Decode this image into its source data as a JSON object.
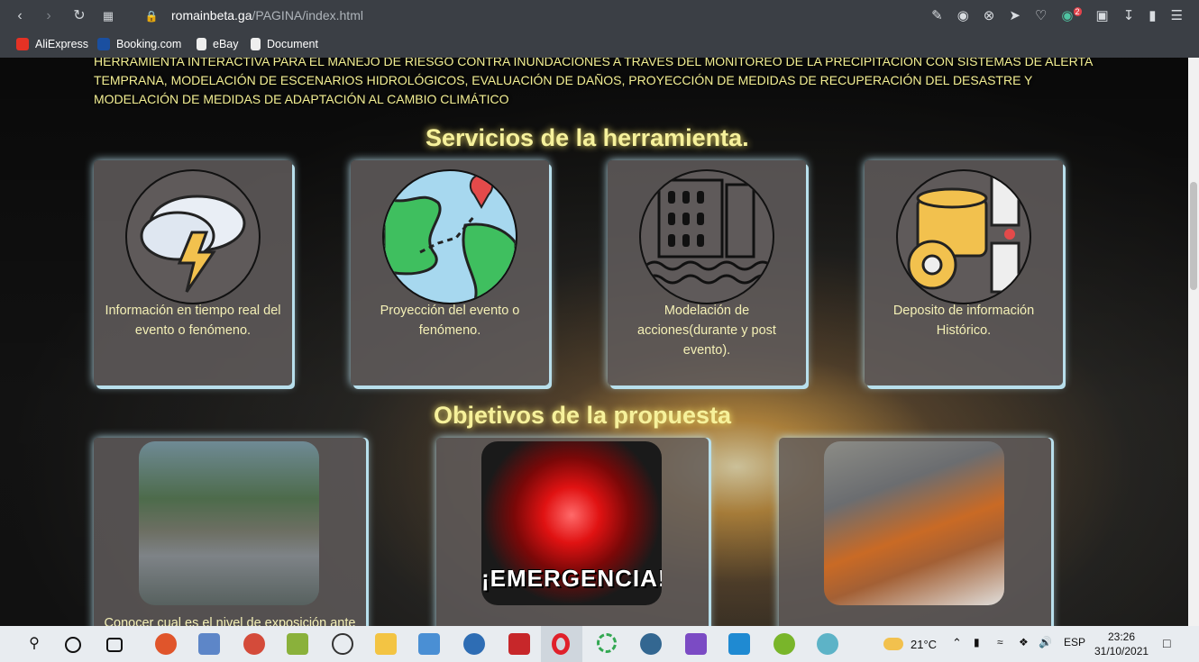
{
  "browser": {
    "url_domain": "romainbeta.ga",
    "url_path": "/PAGINA/index.html",
    "bookmarks": [
      "AliExpress",
      "Booking.com",
      "eBay",
      "Document"
    ],
    "badge_count": "2"
  },
  "page": {
    "intro": "HERRAMIENTA INTERACTIVA PARA EL MANEJO DE RIESGO CONTRA INUNDACIONES A TRAVÉS DEL MONITOREO DE LA PRECIPITACIÓN CON SISTEMAS DE ALERTA TEMPRANA, MODELACIÓN DE ESCENARIOS HIDROLÓGICOS, EVALUACIÓN DE DAÑOS, PROYECCIÓN DE MEDIDAS DE RECUPERACIÓN DEL DESASTRE Y MODELACIÓN DE MEDIDAS DE ADAPTACIÓN AL CAMBIO CLIMÁTICO",
    "services_title": "Servicios de la herramienta.",
    "services": [
      {
        "text": "Información en tiempo real del evento o fenómeno.",
        "icon": "storm-cloud-icon"
      },
      {
        "text": "Proyección del evento o fenómeno.",
        "icon": "map-pin-icon"
      },
      {
        "text": "Modelación de acciones(durante y post evento).",
        "icon": "flooded-city-icon"
      },
      {
        "text": "Deposito de información Histórico.",
        "icon": "database-gear-icon"
      }
    ],
    "objectives_title": "Objetivos de la propuesta",
    "objectives": [
      {
        "text": "Conocer cual es el nivel de exposición ante"
      },
      {
        "text": "¡EMERGENCIA!"
      },
      {
        "text": ""
      }
    ]
  },
  "taskbar": {
    "weather": "21°C",
    "lang": "ESP",
    "time": "23:26",
    "date": "31/10/2021"
  }
}
